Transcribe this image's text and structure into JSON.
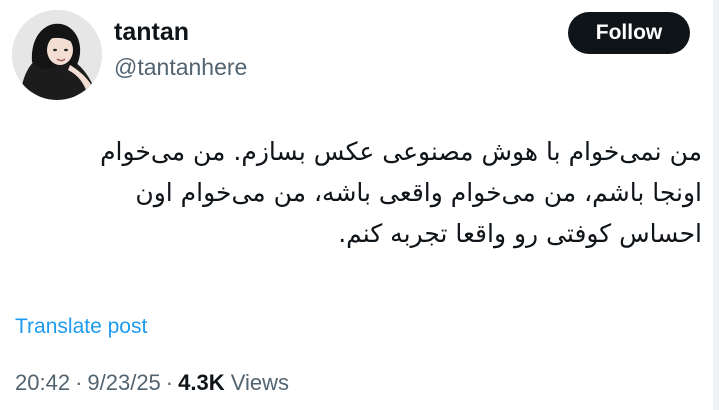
{
  "author": {
    "display_name": "tantan",
    "handle": "@tantanhere",
    "avatar_icon": "profile-photo"
  },
  "actions": {
    "follow_label": "Follow"
  },
  "post": {
    "lines": [
      "من نمی‌خوام با هوش مصنوعی عکس بسازم. من می‌خوام",
      "اونجا باشم، من می‌خوام واقعی باشه، من می‌خوام اون",
      "احساس کوفتی رو واقعا تجربه کنم."
    ],
    "translate_label": "Translate post"
  },
  "meta": {
    "time": "20:42",
    "separator": "·",
    "date": "9/23/25",
    "views_count": "4.3K",
    "views_label": "Views"
  },
  "colors": {
    "text": "#0f1419",
    "secondary": "#536471",
    "link": "#1d9bf0",
    "button_bg": "#0f1419",
    "button_text": "#ffffff"
  }
}
